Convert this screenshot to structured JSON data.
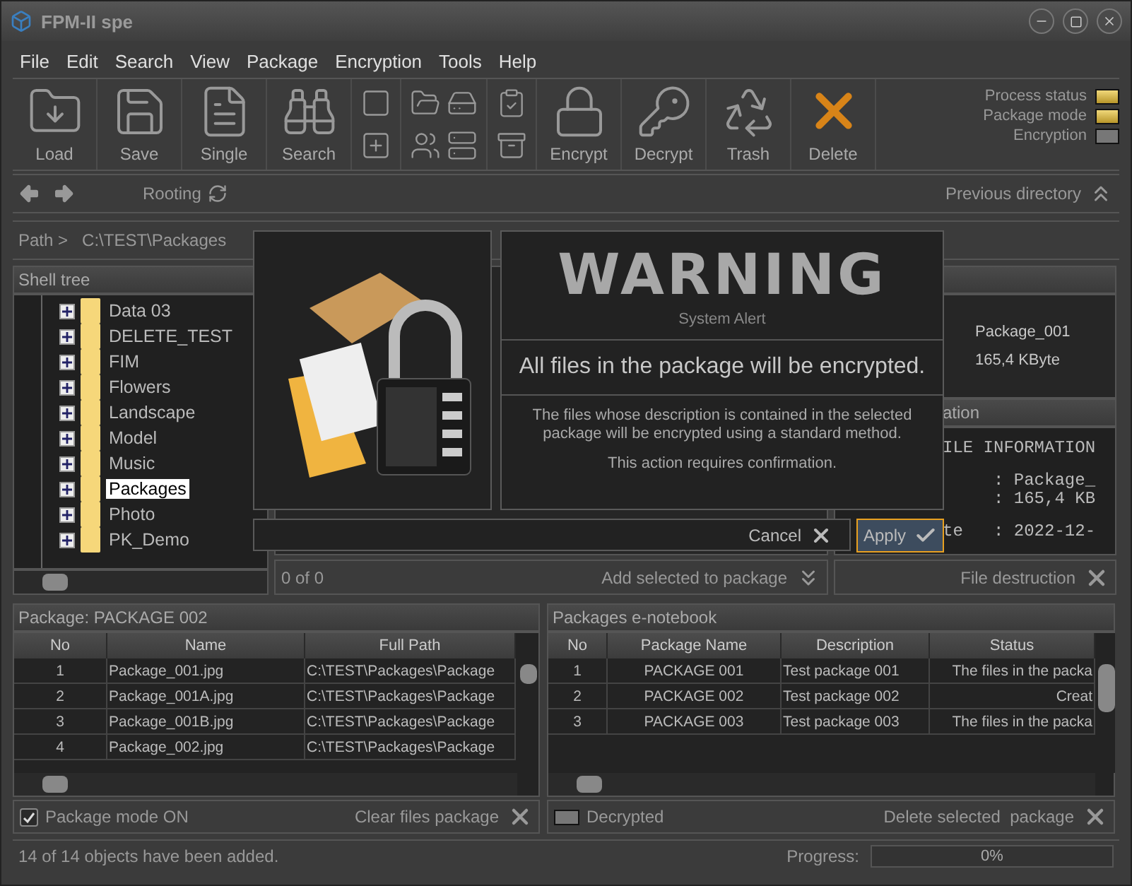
{
  "window": {
    "title": "FPM-II spe"
  },
  "menu": [
    "File",
    "Edit",
    "Search",
    "View",
    "Package",
    "Encryption",
    "Tools",
    "Help"
  ],
  "toolbar": {
    "left": [
      {
        "label": "Load",
        "kind": "load"
      },
      {
        "label": "Save",
        "kind": "save"
      },
      {
        "label": "Single",
        "kind": "single"
      },
      {
        "label": "Search",
        "kind": "search"
      }
    ],
    "right": [
      {
        "label": "Encrypt",
        "kind": "encrypt"
      },
      {
        "label": "Decrypt",
        "kind": "decrypt"
      },
      {
        "label": "Trash",
        "kind": "trash"
      },
      {
        "label": "Delete",
        "kind": "delete"
      }
    ]
  },
  "indicators": [
    {
      "label": "Process status",
      "on": true
    },
    {
      "label": "Package mode",
      "on": true
    },
    {
      "label": "Encryption",
      "on": false
    }
  ],
  "nav": {
    "rooting": "Rooting",
    "previous": "Previous directory"
  },
  "path": {
    "label": "Path >",
    "value": "C:\\TEST\\Packages"
  },
  "shell_tree": {
    "title": "Shell tree",
    "items": [
      {
        "label": "Data 03",
        "selected": false
      },
      {
        "label": "DELETE_TEST",
        "selected": false
      },
      {
        "label": "FIM",
        "selected": false
      },
      {
        "label": "Flowers",
        "selected": false
      },
      {
        "label": "Landscape",
        "selected": false
      },
      {
        "label": "Model",
        "selected": false
      },
      {
        "label": "Music",
        "selected": false
      },
      {
        "label": "Packages",
        "selected": true
      },
      {
        "label": "Photo",
        "selected": false
      },
      {
        "label": "PK_Demo",
        "selected": false
      }
    ]
  },
  "file_list": {
    "count": "0 of 0",
    "add_button": "Add selected to package"
  },
  "file_info": {
    "name": "Package_001",
    "size": "165,4 KByte",
    "section_title": "ation",
    "details": [
      "ILE INFORMATION",
      "     : Package_",
      "     : 165,4 KB",
      "te   : 2022-12-"
    ],
    "destroy_button": "File destruction"
  },
  "dialog": {
    "logo": "WARNING",
    "subtitle": "System Alert",
    "headline": "All files in the package will be encrypted.",
    "body": "The files whose description is contained in the selected package will be encrypted using a standard method.",
    "note": "This action requires confirmation.",
    "buttons": [
      {
        "label": "Cancel",
        "kind": "cancel",
        "focused": false
      },
      {
        "label": "Apply",
        "kind": "apply",
        "focused": true
      }
    ]
  },
  "package_files": {
    "title": "Package: PACKAGE 002",
    "columns": [
      "No",
      "Name",
      "Full Path"
    ],
    "rows": [
      [
        "1",
        "Package_001.jpg",
        "C:\\TEST\\Packages\\Package"
      ],
      [
        "2",
        "Package_001A.jpg",
        "C:\\TEST\\Packages\\Package"
      ],
      [
        "3",
        "Package_001B.jpg",
        "C:\\TEST\\Packages\\Package"
      ],
      [
        "4",
        "Package_002.jpg",
        "C:\\TEST\\Packages\\Package"
      ]
    ],
    "mode_checkbox": {
      "label": "Package mode ON",
      "checked": true
    },
    "clear_button": "Clear files package"
  },
  "notebook": {
    "title": "Packages e-notebook",
    "columns": [
      "No",
      "Package Name",
      "Description",
      "Status"
    ],
    "rows": [
      [
        "1",
        "PACKAGE 001",
        "Test package 001",
        "The files in the packa"
      ],
      [
        "2",
        "PACKAGE 002",
        "Test package 002",
        "Creat"
      ],
      [
        "3",
        "PACKAGE 003",
        "Test package 003",
        "The files in the packa"
      ]
    ],
    "decrypted": {
      "label": "Decrypted",
      "on": false
    },
    "delete_button": "Delete selected  package"
  },
  "status_bar": {
    "message": "14 of 14 objects have been added.",
    "progress_label": "Progress:",
    "progress_text": "0%",
    "level": 0
  }
}
